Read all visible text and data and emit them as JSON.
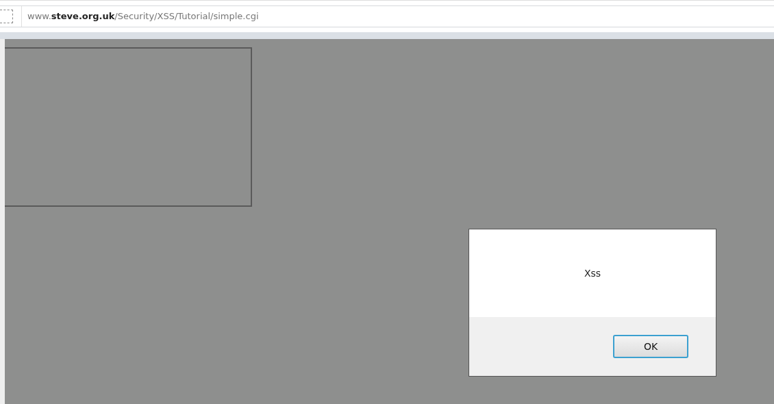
{
  "address_bar": {
    "url": "www.**steve.org.uk**/Security/XSS/Tutorial/simple.cgi"
  },
  "alert_dialog": {
    "message": "Xss",
    "buttons": [
      {
        "label": "OK",
        "focused": true
      }
    ]
  }
}
